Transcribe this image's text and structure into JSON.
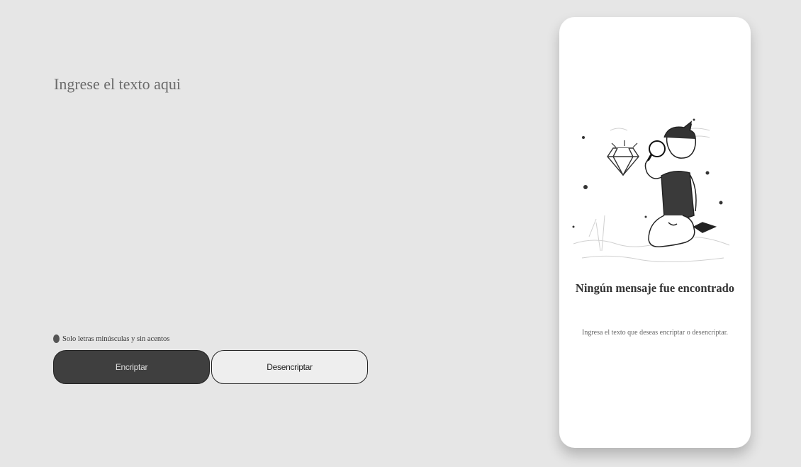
{
  "input": {
    "placeholder": "Ingrese el texto aqui",
    "value": ""
  },
  "hint": {
    "text": "Solo letras minúsculas y sin acentos",
    "icon": "info-icon"
  },
  "buttons": {
    "encrypt_label": "Encriptar",
    "decrypt_label": "Desencriptar"
  },
  "output": {
    "illustration": "person-with-magnifier-illustration",
    "title": "Ningún mensaje fue encontrado",
    "subtitle": "Ingresa el texto que deseas encriptar o desencriptar."
  },
  "colors": {
    "background": "#e6e6e6",
    "panel": "#ffffff",
    "primary_button": "#3f3f3f",
    "secondary_button": "#eeeeee"
  }
}
